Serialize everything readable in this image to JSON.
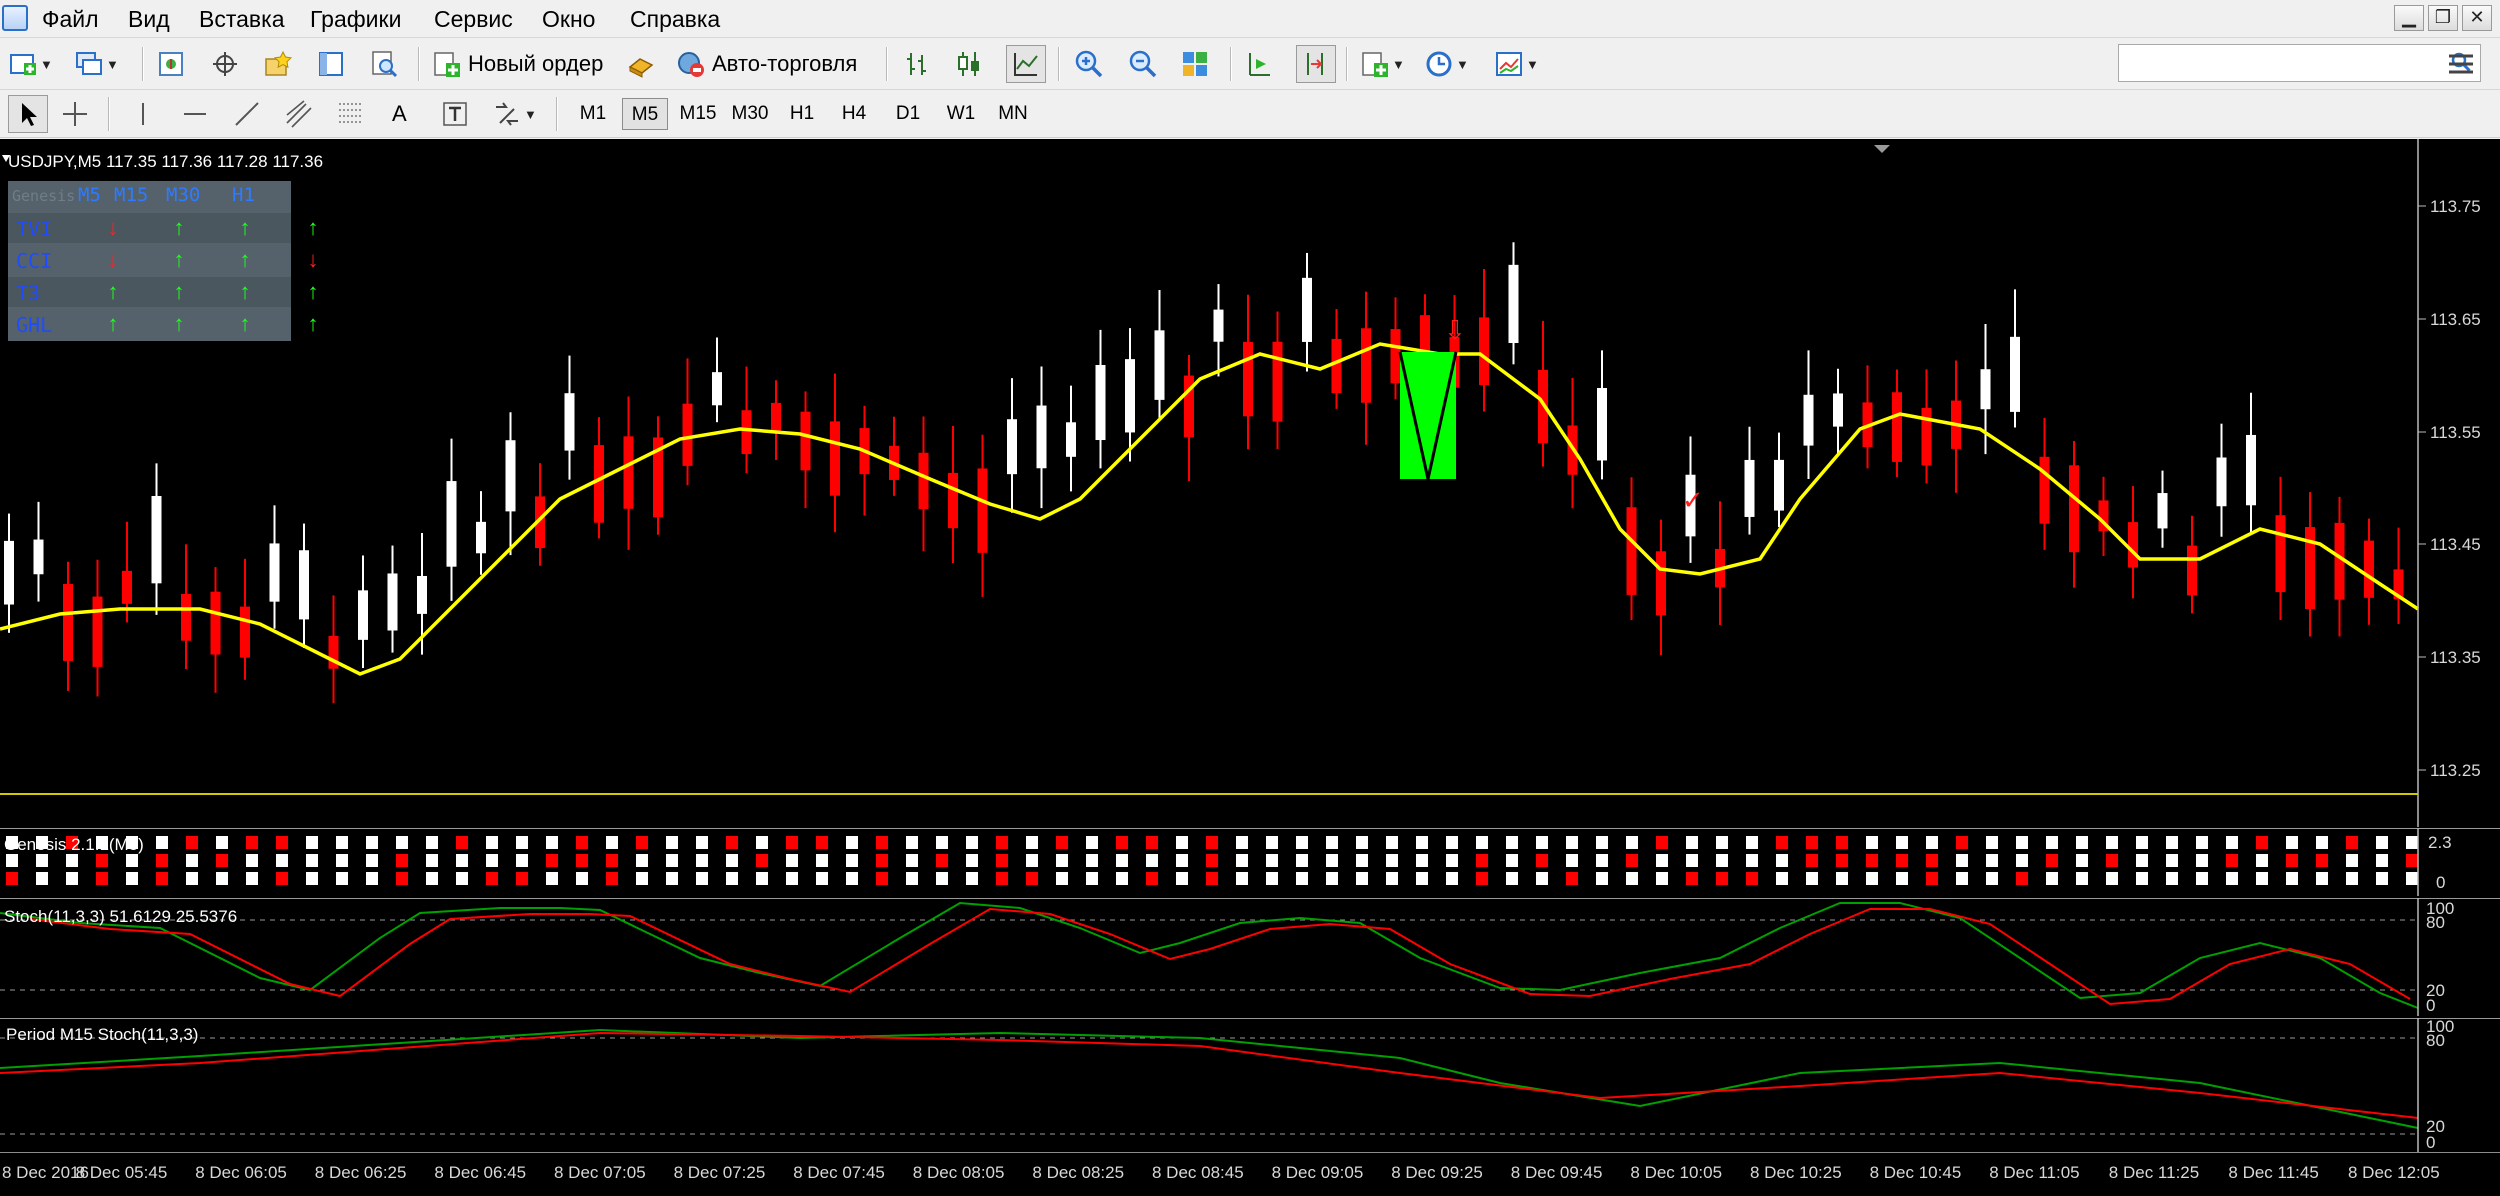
{
  "menu": {
    "items": [
      "Файл",
      "Вид",
      "Вставка",
      "Графики",
      "Сервис",
      "Окно",
      "Справка"
    ]
  },
  "window_controls": {
    "minimize": "▁",
    "restore": "❐",
    "close": "✕"
  },
  "toolbar": {
    "new_order_label": "Новый ордер",
    "auto_trading_label": "Авто-торговля",
    "search_placeholder": ""
  },
  "drawing_tools": {
    "text_label": "A",
    "text_label_tool": "T"
  },
  "timeframes": {
    "items": [
      "M1",
      "M5",
      "M15",
      "M30",
      "H1",
      "H4",
      "D1",
      "W1",
      "MN"
    ],
    "active": "M5"
  },
  "chart": {
    "symbol_info": "USDJPY,M5  117.35 117.36 117.28 117.36",
    "price_labels": [
      "113.75",
      "113.65",
      "113.55",
      "113.45",
      "113.35",
      "113.25"
    ],
    "colors": {
      "bull": "#ffffff",
      "bear": "#ff0000",
      "ma": "#ffff00",
      "highlight": "#00ff00",
      "stoch_main": "#00a000",
      "stoch_signal": "#ff0000"
    }
  },
  "genesis": {
    "title": "Genesis",
    "timeframes": [
      "M5",
      "M15",
      "M30",
      "H1"
    ],
    "rows": [
      {
        "label": "TVI",
        "arrows": [
          "down",
          "up",
          "up",
          "up"
        ]
      },
      {
        "label": "CCI",
        "arrows": [
          "down",
          "up",
          "up",
          "down"
        ]
      },
      {
        "label": "T3",
        "arrows": [
          "up",
          "up",
          "up",
          "up"
        ]
      },
      {
        "label": "GHL",
        "arrows": [
          "up",
          "up",
          "up",
          "up"
        ]
      }
    ],
    "up_glyph": "↑",
    "down_glyph": "↓"
  },
  "indicators": {
    "genesis_label": "Genesis 2.1.1(M5)",
    "genesis_levels": [
      "2.3",
      "0"
    ],
    "stoch_label": "Stoch(11,3,3) 51.6129 25.5376",
    "stoch_levels": [
      "100",
      "80",
      "20",
      "0"
    ],
    "m15_stoch_label": "Period M15 Stoch(11,3,3)",
    "m15_levels": [
      "100",
      "80",
      "20",
      "0"
    ]
  },
  "time_axis": {
    "labels": [
      "8 Dec 2016",
      "8 Dec 05:45",
      "8 Dec 06:05",
      "8 Dec 06:25",
      "8 Dec 06:45",
      "8 Dec 07:05",
      "8 Dec 07:25",
      "8 Dec 07:45",
      "8 Dec 08:05",
      "8 Dec 08:25",
      "8 Dec 08:45",
      "8 Dec 09:05",
      "8 Dec 09:25",
      "8 Dec 09:45",
      "8 Dec 10:05",
      "8 Dec 10:25",
      "8 Dec 10:45",
      "8 Dec 11:05",
      "8 Dec 11:25",
      "8 Dec 11:45",
      "8 Dec 12:05"
    ]
  }
}
